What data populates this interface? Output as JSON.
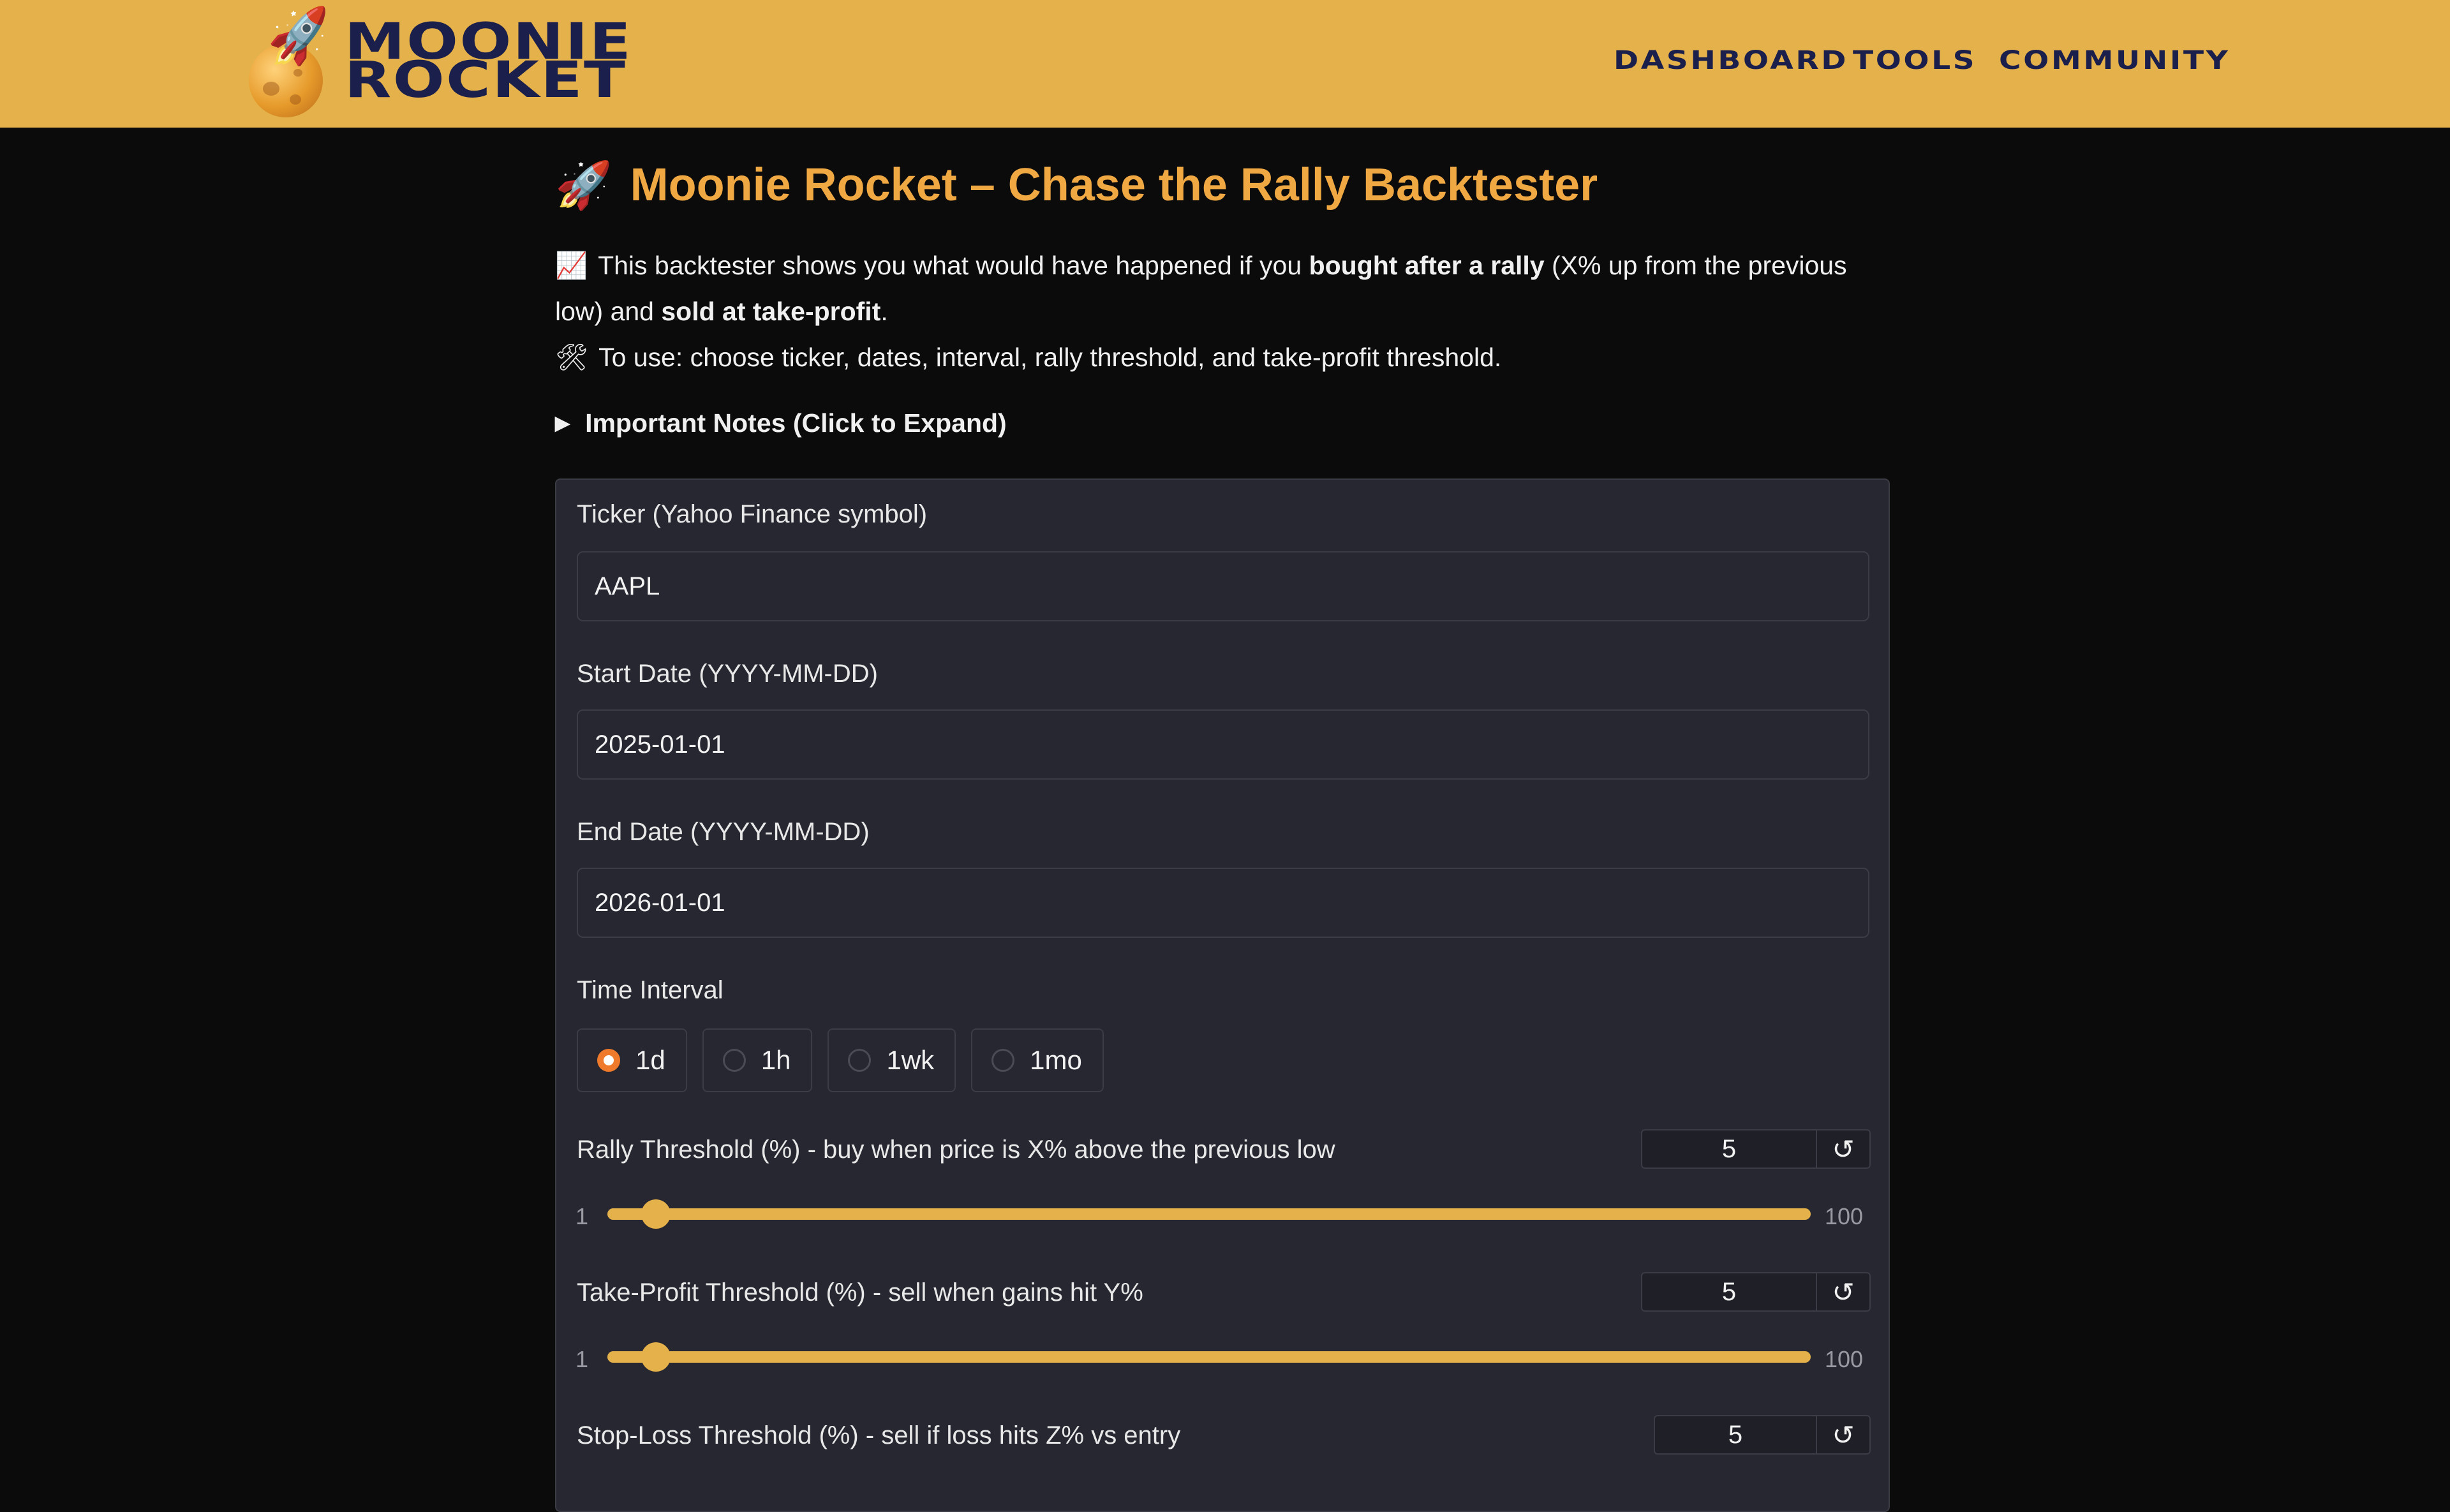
{
  "header": {
    "brand_line1": "MOONIE",
    "brand_line2": "ROCKET",
    "nav": [
      "DASHBOARD",
      "TOOLS",
      "COMMUNITY"
    ]
  },
  "title": "Moonie Rocket – Chase the Rally Backtester",
  "title_icon": "🚀",
  "intro": {
    "line1_icon": "📈",
    "line1_a": "This backtester shows you what would have happened if you ",
    "line1_bold1": "bought after a rally",
    "line1_b": " (X% up from the previous low) and ",
    "line1_bold2": "sold at take-profit",
    "line1_c": ".",
    "line2_icon": "🛠",
    "line2": "To use: choose ticker, dates, interval, rally threshold, and take-profit threshold."
  },
  "notes_label": "Important Notes (Click to Expand)",
  "form": {
    "ticker_label": "Ticker (Yahoo Finance symbol)",
    "ticker_value": "AAPL",
    "start_label": "Start Date (YYYY-MM-DD)",
    "start_value": "2025-01-01",
    "end_label": "End Date (YYYY-MM-DD)",
    "end_value": "2026-01-01",
    "interval_label": "Time Interval",
    "interval_options": [
      "1d",
      "1h",
      "1wk",
      "1mo"
    ],
    "interval_selected": "1d",
    "rally_label": "Rally Threshold (%) - buy when price is X% above the previous low",
    "rally_value": "5",
    "tp_label": "Take-Profit Threshold (%) - sell when gains hit Y%",
    "tp_value": "5",
    "sl_label": "Stop-Loss Threshold (%) - sell if loss hits Z% vs entry",
    "sl_value": "5",
    "slider_min": "1",
    "slider_max": "100",
    "reset_icon": "↺"
  },
  "colors": {
    "header_bg": "#e5b14a",
    "brand_text": "#1b1f4b",
    "title": "#f0a843",
    "slider": "#e5b14a",
    "radio_selected": "#f07a2b"
  }
}
